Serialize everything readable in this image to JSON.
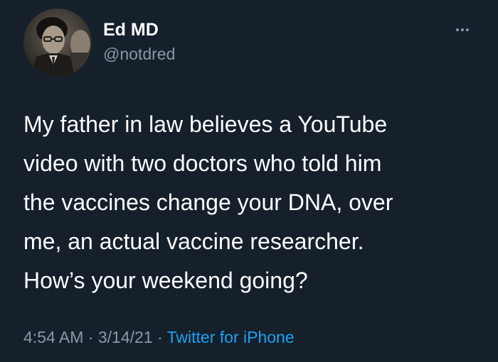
{
  "author": {
    "display_name": "Ed MD",
    "handle": "@notdred"
  },
  "more_icon": "more-horizontal-icon",
  "tweet": {
    "lines": [
      "My father in law believes a YouTube",
      "video with two doctors who told him",
      "the vaccines change your DNA, over",
      "me, an actual vaccine researcher.",
      "How’s your weekend going?"
    ]
  },
  "meta": {
    "time": "4:54 AM",
    "separator": "·",
    "date": "3/14/21",
    "source": "Twitter for iPhone"
  },
  "colors": {
    "background": "#15202b",
    "text": "#ffffff",
    "secondary": "#8899a6",
    "link": "#1da1f2"
  }
}
